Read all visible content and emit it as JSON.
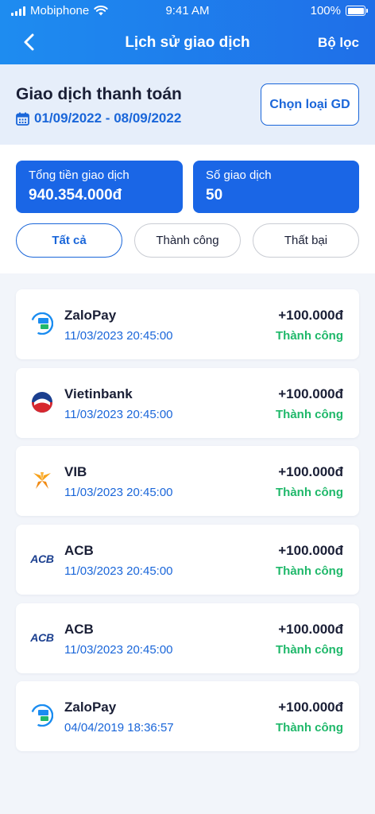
{
  "status_bar": {
    "carrier": "Mobiphone",
    "time": "9:41 AM",
    "battery": "100%"
  },
  "nav": {
    "title": "Lịch sử giao dịch",
    "filter_label": "Bộ lọc"
  },
  "header": {
    "title": "Giao dịch thanh toán",
    "date_range": "01/09/2022 - 08/09/2022",
    "select_type_label": "Chọn loại GD"
  },
  "summary": {
    "total_label": "Tổng tiền giao dịch",
    "total_value": "940.354.000đ",
    "count_label": "Số giao dịch",
    "count_value": "50"
  },
  "tabs": [
    {
      "label": "Tất cả",
      "active": true
    },
    {
      "label": "Thành công",
      "active": false
    },
    {
      "label": "Thất bại",
      "active": false
    }
  ],
  "transactions": [
    {
      "name": "ZaloPay",
      "datetime": "11/03/2023 20:45:00",
      "amount": "+100.000đ",
      "status": "Thành công",
      "logo": "zalopay-icon"
    },
    {
      "name": "Vietinbank",
      "datetime": "11/03/2023 20:45:00",
      "amount": "+100.000đ",
      "status": "Thành công",
      "logo": "vietinbank-icon"
    },
    {
      "name": "VIB",
      "datetime": "11/03/2023 20:45:00",
      "amount": "+100.000đ",
      "status": "Thành công",
      "logo": "vib-icon"
    },
    {
      "name": "ACB",
      "datetime": "11/03/2023 20:45:00",
      "amount": "+100.000đ",
      "status": "Thành công",
      "logo": "acb-icon",
      "logo_text": "ACB"
    },
    {
      "name": "ACB",
      "datetime": "11/03/2023 20:45:00",
      "amount": "+100.000đ",
      "status": "Thành công",
      "logo": "acb-icon",
      "logo_text": "ACB"
    },
    {
      "name": "ZaloPay",
      "datetime": "04/04/2019 18:36:57",
      "amount": "+100.000đ",
      "status": "Thành công",
      "logo": "zalopay-icon"
    }
  ],
  "colors": {
    "primary": "#1a66d9",
    "success": "#1fb86a",
    "header_bg": "#1e8cf0"
  }
}
